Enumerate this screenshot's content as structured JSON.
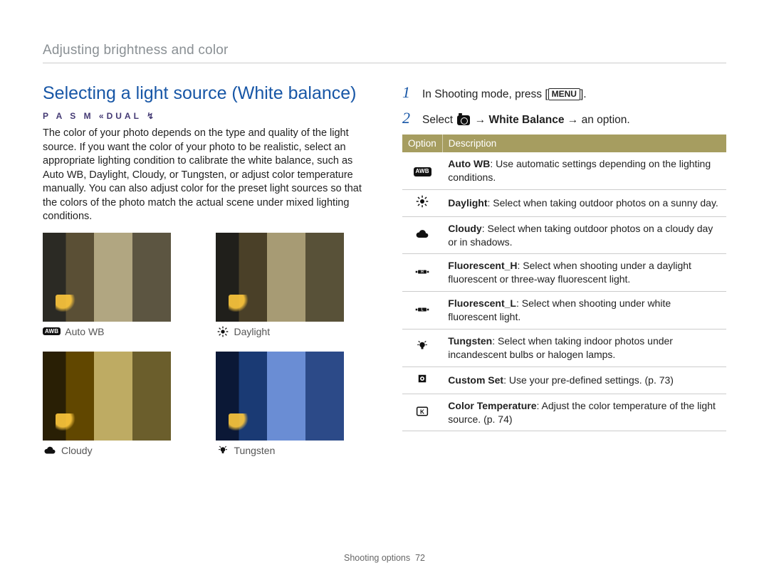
{
  "breadcrumb": "Adjusting brightness and color",
  "section_title": "Selecting a light source (White balance)",
  "modes_line": "P A S M «DUAL ↯",
  "intro_text": "The color of your photo depends on the type and quality of the light source. If you want the color of your photo to be realistic, select an appropriate lighting condition to calibrate the white balance, such as Auto WB, Daylight, Cloudy, or Tungsten, or adjust color temperature manually. You can also adjust color for the preset light sources so that the colors of the photo match the actual scene under mixed lighting conditions.",
  "thumbs": {
    "auto_wb": "Auto WB",
    "daylight": "Daylight",
    "cloudy": "Cloudy",
    "tungsten": "Tungsten",
    "awb_badge": "AWB"
  },
  "steps": {
    "s1_num": "1",
    "s1_a": "In Shooting mode, press [",
    "s1_menu": "MENU",
    "s1_b": "].",
    "s2_num": "2",
    "s2_a": "Select ",
    "s2_arrow": " → ",
    "s2_wb": "White Balance",
    "s2_b": " an option.",
    "s2_arrow2": " → "
  },
  "table": {
    "h_option": "Option",
    "h_description": "Description",
    "rows": [
      {
        "icon": "awb",
        "title": "Auto WB",
        "text": ": Use automatic settings depending on the lighting conditions."
      },
      {
        "icon": "daylight",
        "title": "Daylight",
        "text": ": Select when taking outdoor photos on a sunny day."
      },
      {
        "icon": "cloudy",
        "title": "Cloudy",
        "text": ": Select when taking outdoor photos on a cloudy day or in shadows."
      },
      {
        "icon": "fluor_h",
        "title": "Fluorescent_H",
        "text": ": Select when shooting under a daylight fluorescent or three-way fluorescent light."
      },
      {
        "icon": "fluor_l",
        "title": "Fluorescent_L",
        "text": ": Select when shooting under white fluorescent light."
      },
      {
        "icon": "tungsten",
        "title": "Tungsten",
        "text": ": Select when taking indoor photos under incandescent bulbs or halogen lamps."
      },
      {
        "icon": "custom",
        "title": "Custom Set",
        "text": ": Use your pre-defined settings. (p. 73)"
      },
      {
        "icon": "k",
        "title": "Color Temperature",
        "text": ": Adjust the color temperature of the light source. (p. 74)"
      }
    ]
  },
  "footer": {
    "label": "Shooting options",
    "page": "72"
  }
}
